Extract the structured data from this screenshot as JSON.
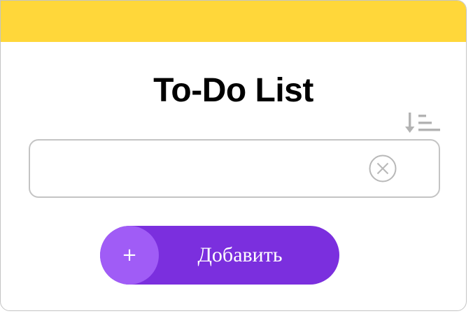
{
  "header": {
    "title": "To-Do List",
    "accent_color": "#ffd73a"
  },
  "toolbar": {
    "sort_icon": "sort-ascending-icon"
  },
  "task_input": {
    "value": "",
    "placeholder": "",
    "clear_icon": "clear-circle-x-icon"
  },
  "add_button": {
    "icon_glyph": "+",
    "label": "Добавить",
    "color": "#7b2fde",
    "icon_bg_color": "#a05cf6"
  }
}
